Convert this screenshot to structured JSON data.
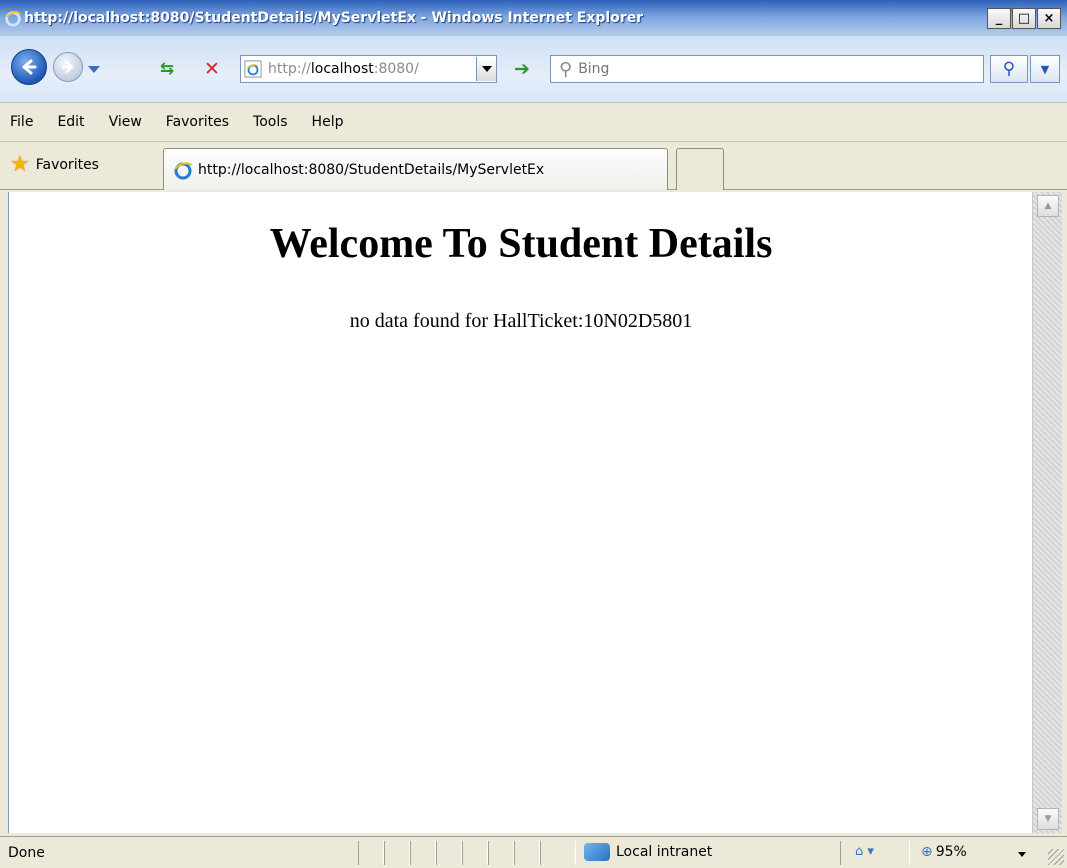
{
  "window": {
    "title": "http://localhost:8080/StudentDetails/MyServletEx - Windows Internet Explorer",
    "minimize_label": "_",
    "maximize_label": "□",
    "close_label": "×"
  },
  "navigation": {
    "address_prefix": "http://",
    "address_host": "localhost",
    "address_suffix": ":8080/",
    "search_placeholder": "Bing",
    "icons": {
      "back": "back-arrow-icon",
      "forward": "forward-arrow-icon",
      "refresh": "refresh-icon",
      "stop": "stop-icon",
      "go": "go-arrow-icon",
      "search": "search-icon"
    }
  },
  "menu": {
    "items": [
      {
        "label": "File"
      },
      {
        "label": "Edit"
      },
      {
        "label": "View"
      },
      {
        "label": "Favorites"
      },
      {
        "label": "Tools"
      },
      {
        "label": "Help"
      }
    ]
  },
  "favorites_bar": {
    "favorites_label": "Favorites",
    "tab_title": "http://localhost:8080/StudentDetails/MyServletEx"
  },
  "page": {
    "heading": "Welcome To Student Details",
    "message": "no data found for HallTicket:10N02D5801"
  },
  "status": {
    "text": "Done",
    "zone": "Local intranet",
    "zoom": "95%"
  },
  "colors": {
    "titlebar": "#2b5fb8",
    "chrome": "#ece9d8",
    "ie_logo": "#1e7fd9"
  }
}
